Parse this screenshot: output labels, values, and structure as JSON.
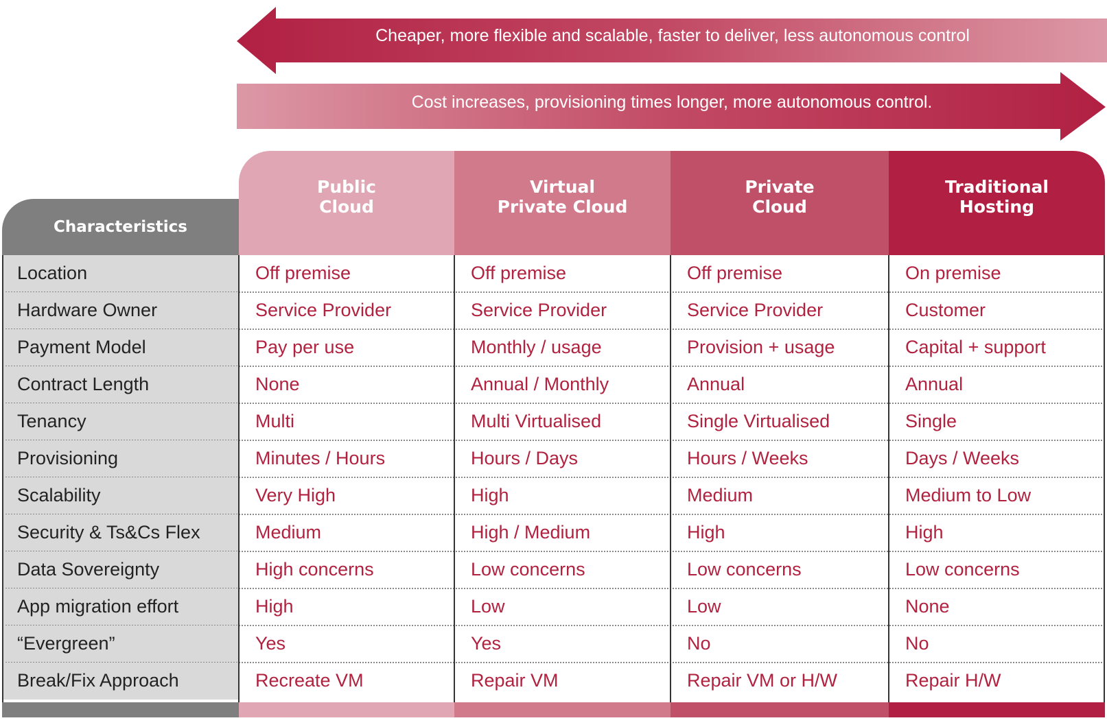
{
  "arrows": {
    "left": {
      "text": "Cheaper, more flexible and scalable, faster to deliver, less autonomous control",
      "direction": "left"
    },
    "right": {
      "text": "Cost increases, provisioning times longer, more autonomous control.",
      "direction": "right"
    }
  },
  "colors": {
    "dark_red": "#b12042",
    "mid_red": "#c05068",
    "mid_pink": "#d07a8c",
    "light_pink": "#e0a6b3",
    "grey_header": "#7f7f7f",
    "label_bg": "#d9d9d9",
    "value_text": "#b0223f"
  },
  "table": {
    "characteristics_header": "Characteristics",
    "columns": [
      {
        "line1": "Public",
        "line2": "Cloud"
      },
      {
        "line1": "Virtual",
        "line2": "Private Cloud"
      },
      {
        "line1": "Private",
        "line2": "Cloud"
      },
      {
        "line1": "Traditional",
        "line2": "Hosting"
      }
    ],
    "rows": [
      {
        "label": "Location",
        "values": [
          "Off premise",
          "Off premise",
          "Off premise",
          "On premise"
        ]
      },
      {
        "label": "Hardware Owner",
        "values": [
          "Service Provider",
          "Service Provider",
          "Service Provider",
          "Customer"
        ]
      },
      {
        "label": "Payment Model",
        "values": [
          "Pay per use",
          "Monthly / usage",
          "Provision + usage",
          "Capital + support"
        ]
      },
      {
        "label": "Contract Length",
        "values": [
          "None",
          "Annual / Monthly",
          "Annual",
          "Annual"
        ]
      },
      {
        "label": "Tenancy",
        "values": [
          "Multi",
          "Multi Virtualised",
          "Single Virtualised",
          "Single"
        ]
      },
      {
        "label": "Provisioning",
        "values": [
          "Minutes / Hours",
          "Hours / Days",
          "Hours / Weeks",
          "Days / Weeks"
        ]
      },
      {
        "label": "Scalability",
        "values": [
          "Very High",
          "High",
          "Medium",
          "Medium to Low"
        ]
      },
      {
        "label": "Security & Ts&Cs Flex",
        "values": [
          "Medium",
          "High / Medium",
          "High",
          "High"
        ]
      },
      {
        "label": "Data Sovereignty",
        "values": [
          "High concerns",
          "Low concerns",
          "Low concerns",
          "Low concerns"
        ]
      },
      {
        "label": "App migration effort",
        "values": [
          "High",
          "Low",
          "Low",
          "None"
        ]
      },
      {
        "label": "“Evergreen”",
        "values": [
          "Yes",
          "Yes",
          "No",
          "No"
        ]
      },
      {
        "label": "Break/Fix Approach",
        "values": [
          "Recreate VM",
          "Repair VM",
          "Repair VM or H/W",
          "Repair H/W"
        ]
      }
    ]
  }
}
